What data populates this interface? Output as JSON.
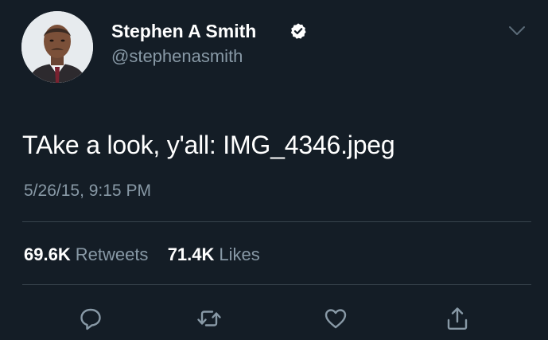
{
  "author": {
    "display_name": "Stephen A Smith",
    "handle": "@stephenasmith",
    "verified": true,
    "avatar_icon": "profile-photo"
  },
  "tweet": {
    "text": "TAke a look, y'all: IMG_4346.jpeg",
    "timestamp": "5/26/15, 9:15 PM"
  },
  "stats": {
    "retweets_count": "69.6K",
    "retweets_label": "Retweets",
    "likes_count": "71.4K",
    "likes_label": "Likes"
  },
  "actions": [
    {
      "name": "reply",
      "icon": "reply-icon"
    },
    {
      "name": "retweet",
      "icon": "retweet-icon"
    },
    {
      "name": "like",
      "icon": "heart-icon"
    },
    {
      "name": "share",
      "icon": "share-icon"
    }
  ],
  "colors": {
    "background": "#141d26",
    "primary_text": "#ffffff",
    "secondary_text": "#8899a6",
    "divider": "#38444d"
  }
}
